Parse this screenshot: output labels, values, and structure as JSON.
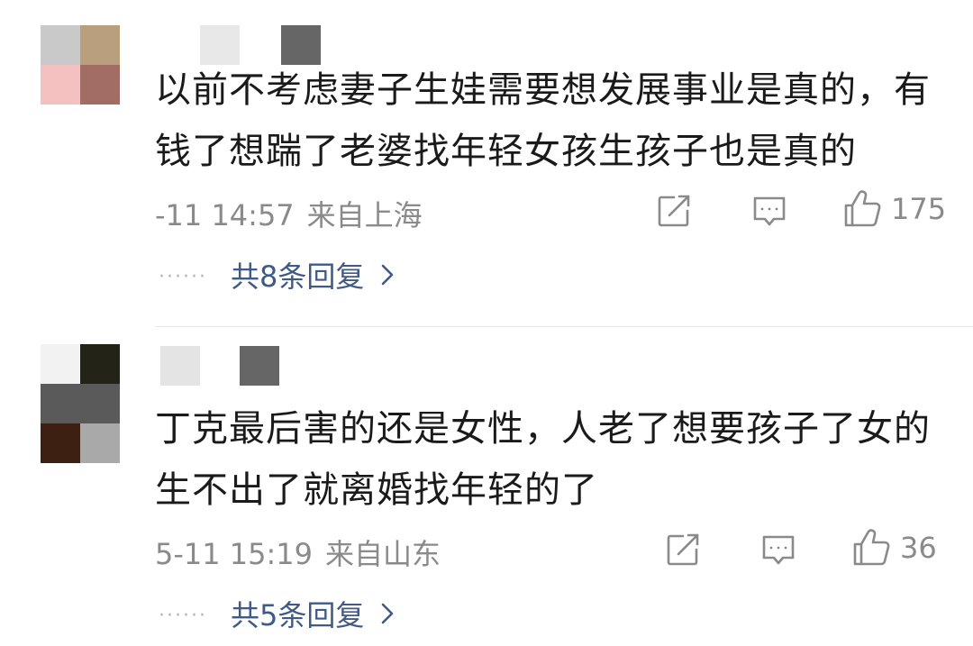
{
  "comments": [
    {
      "text": "以前不考虑妻子生娃需要想发展事业是真的，有钱了想踹了老婆找年轻女孩生孩子也是真的",
      "time": "-11 14:57",
      "location": "来自上海",
      "likes": "175",
      "replies": "共8条回复",
      "avatar_colors": [
        "#c9c9c9",
        "#b99f7e",
        "#f4c0c0",
        "#a26e64"
      ]
    },
    {
      "text": "丁克最后害的还是女性，人老了想要孩子了女的生不出了就离婚找年轻的了",
      "time": "5-11 15:19",
      "location": "来自山东",
      "likes": "36",
      "replies": "共5条回复",
      "avatar_colors": [
        "#f2f2f2",
        "#232318",
        "#5a5a5a",
        "#5a5a5a",
        "#3e2013",
        "#a9a9a9"
      ]
    }
  ],
  "icons": {
    "share": "share-icon",
    "comment": "comment-icon",
    "like": "thumbs-up-icon",
    "chevron": "chevron-right-icon"
  },
  "colors": {
    "text": "#1a1a1a",
    "meta": "#8a8a8a",
    "link": "#3f5a86"
  }
}
